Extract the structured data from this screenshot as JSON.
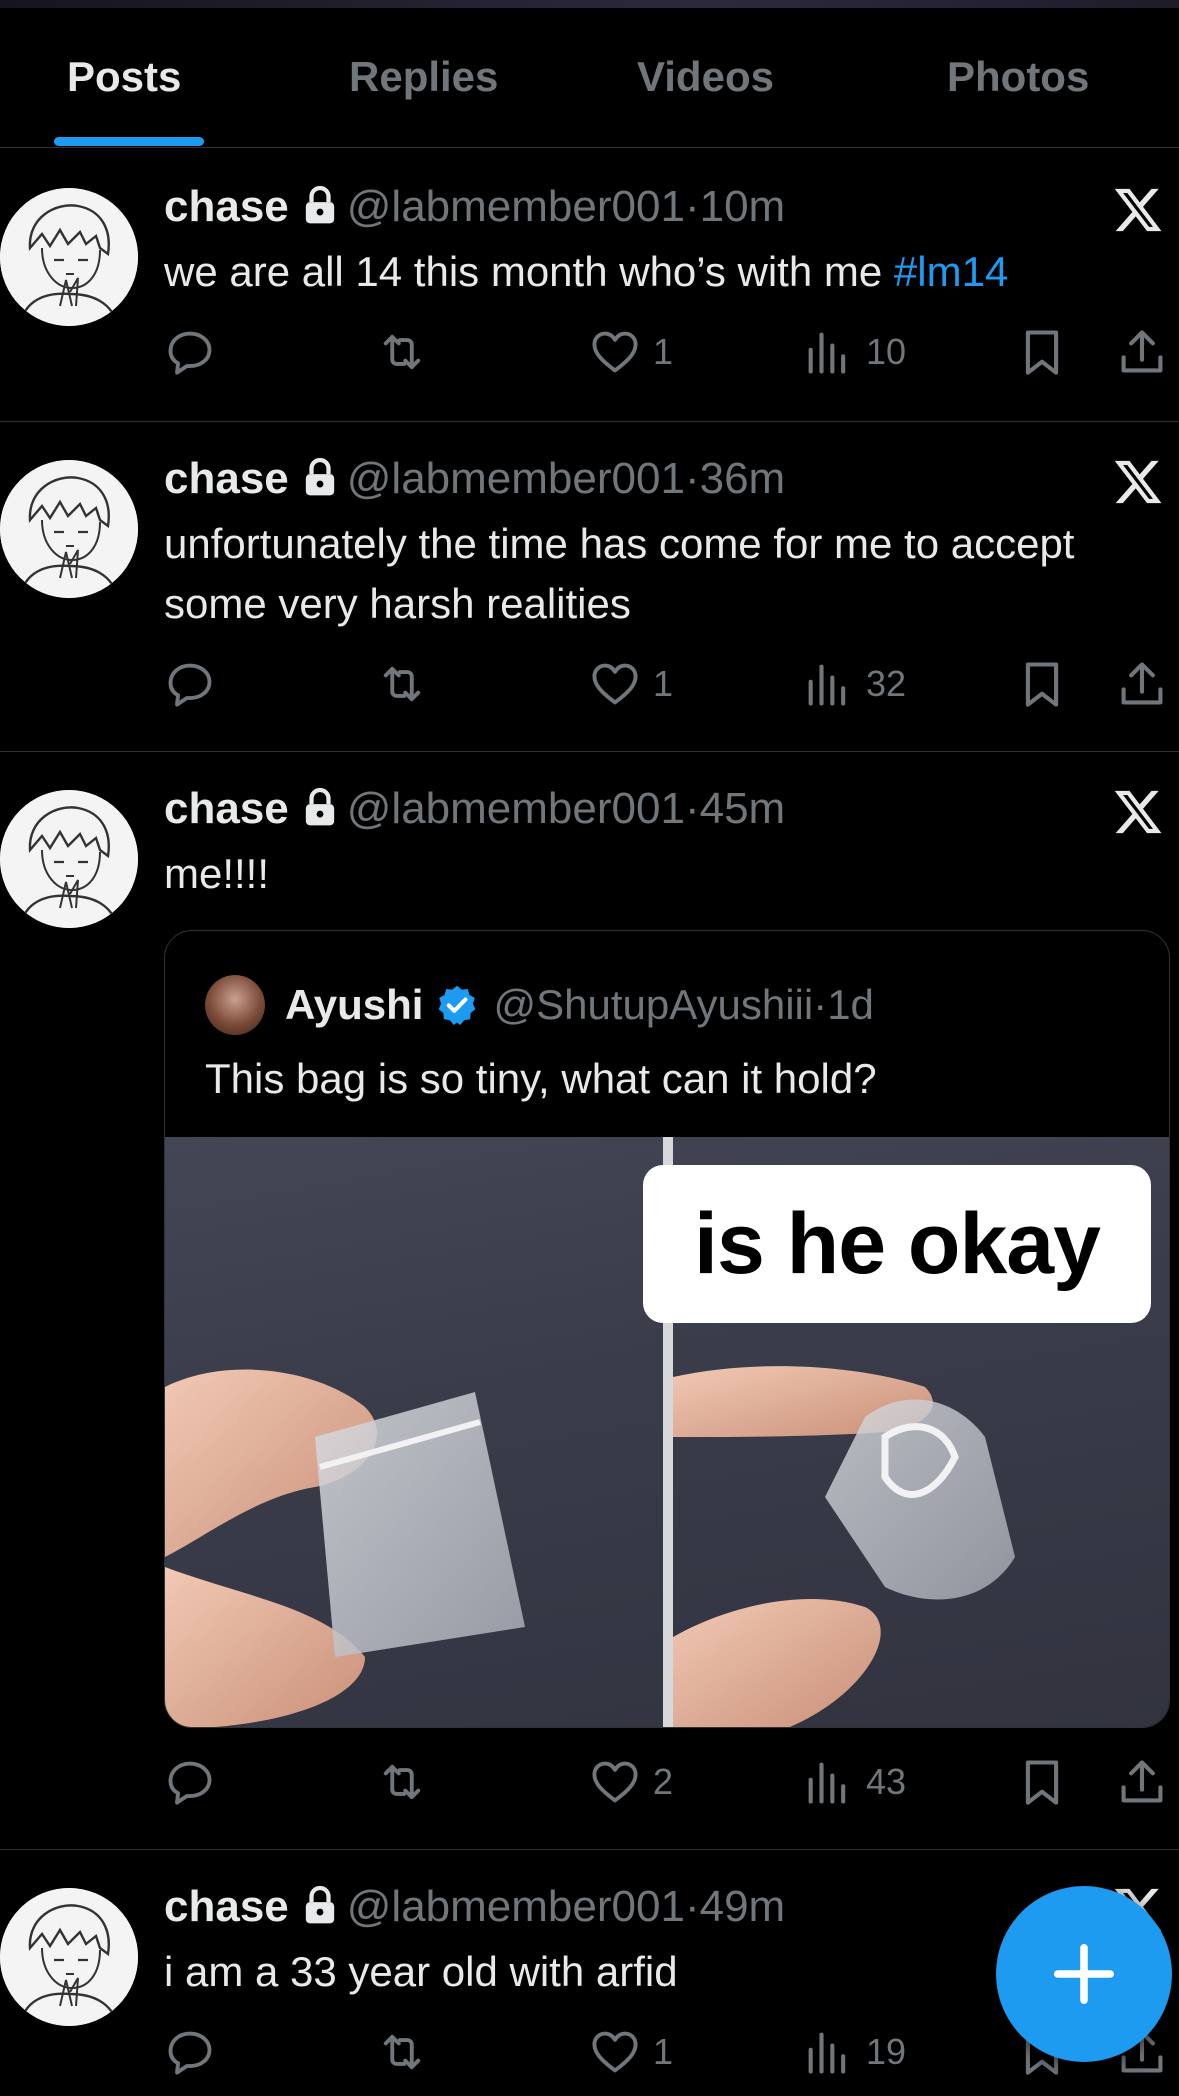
{
  "tabs": [
    {
      "label": "Posts",
      "active": true
    },
    {
      "label": "Replies",
      "active": false
    },
    {
      "label": "Videos",
      "active": false
    },
    {
      "label": "Photos",
      "active": false
    }
  ],
  "colors": {
    "accent": "#1d9bf0",
    "muted": "#71767b",
    "text": "#e7e9ea",
    "background": "#000000"
  },
  "posts": [
    {
      "name": "chase",
      "handle": "@labmember001",
      "separator": "·",
      "time": "10m",
      "text": "we are all 14 this month who’s with me ",
      "hashtag": "#lm14",
      "replies": "",
      "reposts": "",
      "likes": "1",
      "views": "10"
    },
    {
      "name": "chase",
      "handle": "@labmember001",
      "separator": "·",
      "time": "36m",
      "text": "unfortunately the time has come for me to accept some very harsh realities",
      "replies": "",
      "reposts": "",
      "likes": "1",
      "views": "32"
    },
    {
      "name": "chase",
      "handle": "@labmember001",
      "separator": "·",
      "time": "45m",
      "text": "me!!!!",
      "quote": {
        "name": "Ayushi",
        "handle": "@ShutupAyushiii",
        "separator": "·",
        "time": "1d",
        "text": "This bag is so tiny, what can it hold?",
        "media_caption": "is he okay"
      },
      "replies": "",
      "reposts": "",
      "likes": "2",
      "views": "43"
    },
    {
      "name": "chase",
      "handle": "@labmember001",
      "separator": "·",
      "time": "49m",
      "text": "i am a 33 year old with arfid",
      "replies": "",
      "reposts": "",
      "likes": "1",
      "views": "19"
    }
  ],
  "icons": {
    "lock": "lock-icon",
    "x_logo": "x-logo-icon",
    "reply": "reply-icon",
    "repost": "repost-icon",
    "like": "heart-icon",
    "views": "views-icon",
    "bookmark": "bookmark-icon",
    "share": "share-icon",
    "verified": "verified-badge-icon",
    "compose": "plus-icon"
  }
}
